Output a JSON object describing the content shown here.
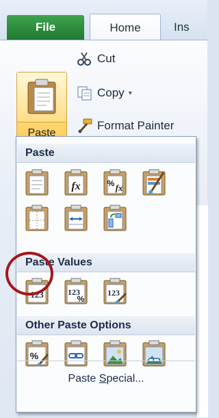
{
  "tabs": {
    "file": "File",
    "home": "Home",
    "insert_partial": "Ins"
  },
  "clipboard": {
    "paste_label": "Paste",
    "paste_caret": "▾",
    "cut": "Cut",
    "copy": "Copy",
    "copy_caret": "▾",
    "format_painter": "Format Painter"
  },
  "paste_menu": {
    "paste_header": "Paste",
    "paste_values_header": "Paste Values",
    "other_options_header": "Other Paste Options",
    "paste_special": "Paste Special...",
    "paste_special_prefix": "Paste ",
    "paste_special_underlined": "S",
    "paste_special_suffix": "pecial...",
    "paste_icons": [
      "paste-icon",
      "formulas-icon",
      "formulas-number-formatting-icon",
      "keep-source-formatting-icon",
      "no-borders-icon",
      "keep-column-widths-icon",
      "transpose-icon"
    ],
    "paste_values_icons": [
      "values-icon",
      "values-number-formatting-icon",
      "values-source-formatting-icon"
    ],
    "other_icons": [
      "formatting-icon",
      "paste-link-icon",
      "picture-icon",
      "linked-picture-icon"
    ],
    "values_label": "123",
    "highlighted": "values-icon"
  },
  "colors": {
    "file_tab": "#1e7a2f",
    "highlight_circle": "#a4161a",
    "section_header_text": "#1b2d4a"
  }
}
